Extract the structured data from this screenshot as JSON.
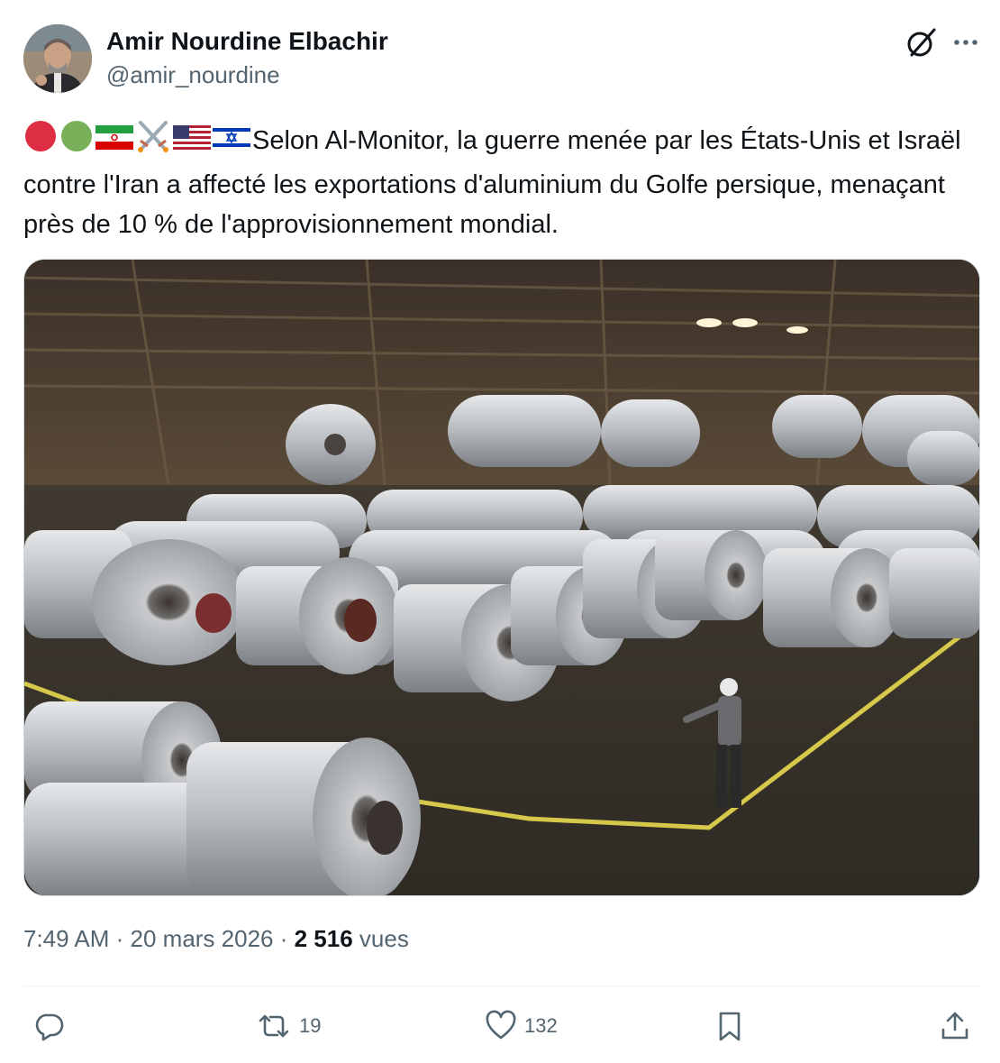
{
  "author": {
    "name": "Amir Nourdine Elbachir",
    "handle": "@amir_nourdine"
  },
  "icons": {
    "grok": "grok-icon",
    "more": "more-icon",
    "reply": "reply-icon",
    "retweet": "retweet-icon",
    "like": "heart-icon",
    "bookmark": "bookmark-icon",
    "share": "share-icon"
  },
  "tweet": {
    "text": "Selon Al-Monitor, la guerre menée par les États-Unis et Israël contre l'Iran a affecté les exportations d'aluminium du Golfe persique, menaçant près de 10 % de l'approvisionnement mondial.",
    "emoji_prefix": [
      "red-circle",
      "green-circle",
      "iran-flag",
      "crossed-swords",
      "us-flag",
      "israel-flag"
    ]
  },
  "meta": {
    "time": "7:49 AM",
    "sep1": " · ",
    "date": "20 mars 2026",
    "sep2": " · ",
    "views_count": "2 516",
    "views_label": "vues"
  },
  "actions": {
    "retweets": "19",
    "likes": "132"
  },
  "colors": {
    "text": "#0f1419",
    "secondary": "#536471",
    "border": "#cfd9de"
  }
}
